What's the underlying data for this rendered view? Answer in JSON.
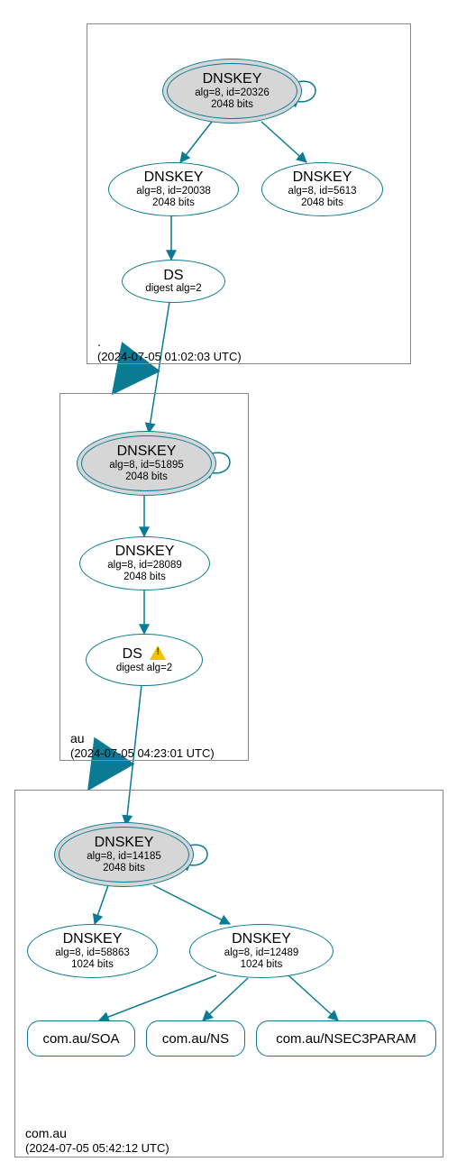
{
  "zones": {
    "root": {
      "label": ".",
      "timestamp": "(2024-07-05 01:02:03 UTC)",
      "nodes": {
        "ksk": {
          "title": "DNSKEY",
          "sub1": "alg=8, id=20326",
          "sub2": "2048 bits"
        },
        "zsk1": {
          "title": "DNSKEY",
          "sub1": "alg=8, id=20038",
          "sub2": "2048 bits"
        },
        "zsk2": {
          "title": "DNSKEY",
          "sub1": "alg=8, id=5613",
          "sub2": "2048 bits"
        },
        "ds": {
          "title": "DS",
          "sub1": "digest alg=2"
        }
      }
    },
    "au": {
      "label": "au",
      "timestamp": "(2024-07-05 04:23:01 UTC)",
      "nodes": {
        "ksk": {
          "title": "DNSKEY",
          "sub1": "alg=8, id=51895",
          "sub2": "2048 bits"
        },
        "zsk": {
          "title": "DNSKEY",
          "sub1": "alg=8, id=28089",
          "sub2": "2048 bits"
        },
        "ds": {
          "title": "DS",
          "sub1": "digest alg=2"
        }
      }
    },
    "comau": {
      "label": "com.au",
      "timestamp": "(2024-07-05 05:42:12 UTC)",
      "nodes": {
        "ksk": {
          "title": "DNSKEY",
          "sub1": "alg=8, id=14185",
          "sub2": "2048 bits"
        },
        "zsk1": {
          "title": "DNSKEY",
          "sub1": "alg=8, id=58863",
          "sub2": "1024 bits"
        },
        "zsk2": {
          "title": "DNSKEY",
          "sub1": "alg=8, id=12489",
          "sub2": "1024 bits"
        },
        "rr_soa": {
          "label": "com.au/SOA"
        },
        "rr_ns": {
          "label": "com.au/NS"
        },
        "rr_n3p": {
          "label": "com.au/NSEC3PARAM"
        }
      }
    }
  },
  "chart_data": {
    "type": "diagram",
    "title": "DNSSEC authentication chain for com.au",
    "zones": [
      {
        "name": ".",
        "timestamp_utc": "2024-07-05 01:02:03",
        "keys": [
          {
            "id": "root-ksk",
            "role": "KSK",
            "type": "DNSKEY",
            "alg": 8,
            "key_id": 20326,
            "bits": 2048
          },
          {
            "id": "root-zsk-20038",
            "role": "ZSK",
            "type": "DNSKEY",
            "alg": 8,
            "key_id": 20038,
            "bits": 2048
          },
          {
            "id": "root-zsk-5613",
            "role": "ZSK",
            "type": "DNSKEY",
            "alg": 8,
            "key_id": 5613,
            "bits": 2048
          }
        ],
        "ds": [
          {
            "id": "root-ds-au",
            "digest_alg": 2,
            "for_zone": "au"
          }
        ]
      },
      {
        "name": "au",
        "timestamp_utc": "2024-07-05 04:23:01",
        "keys": [
          {
            "id": "au-ksk",
            "role": "KSK",
            "type": "DNSKEY",
            "alg": 8,
            "key_id": 51895,
            "bits": 2048
          },
          {
            "id": "au-zsk",
            "role": "ZSK",
            "type": "DNSKEY",
            "alg": 8,
            "key_id": 28089,
            "bits": 2048
          }
        ],
        "ds": [
          {
            "id": "au-ds-comau",
            "digest_alg": 2,
            "for_zone": "com.au",
            "warning": true
          }
        ]
      },
      {
        "name": "com.au",
        "timestamp_utc": "2024-07-05 05:42:12",
        "keys": [
          {
            "id": "comau-ksk",
            "role": "KSK",
            "type": "DNSKEY",
            "alg": 8,
            "key_id": 14185,
            "bits": 2048
          },
          {
            "id": "comau-zsk-58863",
            "role": "ZSK",
            "type": "DNSKEY",
            "alg": 8,
            "key_id": 58863,
            "bits": 1024
          },
          {
            "id": "comau-zsk-12489",
            "role": "ZSK",
            "type": "DNSKEY",
            "alg": 8,
            "key_id": 12489,
            "bits": 1024
          }
        ],
        "rrsets": [
          "com.au/SOA",
          "com.au/NS",
          "com.au/NSEC3PARAM"
        ]
      }
    ],
    "edges": [
      {
        "from": "root-ksk",
        "to": "root-ksk",
        "kind": "self-sign"
      },
      {
        "from": "root-ksk",
        "to": "root-zsk-20038",
        "kind": "signs"
      },
      {
        "from": "root-ksk",
        "to": "root-zsk-5613",
        "kind": "signs"
      },
      {
        "from": "root-zsk-20038",
        "to": "root-ds-au",
        "kind": "signs"
      },
      {
        "from": "root-ds-au",
        "to": "au-ksk",
        "kind": "delegation"
      },
      {
        "from": "au-ksk",
        "to": "au-ksk",
        "kind": "self-sign"
      },
      {
        "from": "au-ksk",
        "to": "au-zsk",
        "kind": "signs"
      },
      {
        "from": "au-zsk",
        "to": "au-ds-comau",
        "kind": "signs"
      },
      {
        "from": "au-ds-comau",
        "to": "comau-ksk",
        "kind": "delegation"
      },
      {
        "from": "comau-ksk",
        "to": "comau-ksk",
        "kind": "self-sign"
      },
      {
        "from": "comau-ksk",
        "to": "comau-zsk-58863",
        "kind": "signs"
      },
      {
        "from": "comau-ksk",
        "to": "comau-zsk-12489",
        "kind": "signs"
      },
      {
        "from": "comau-zsk-12489",
        "to": "com.au/SOA",
        "kind": "signs"
      },
      {
        "from": "comau-zsk-12489",
        "to": "com.au/NS",
        "kind": "signs"
      },
      {
        "from": "comau-zsk-12489",
        "to": "com.au/NSEC3PARAM",
        "kind": "signs"
      }
    ]
  }
}
